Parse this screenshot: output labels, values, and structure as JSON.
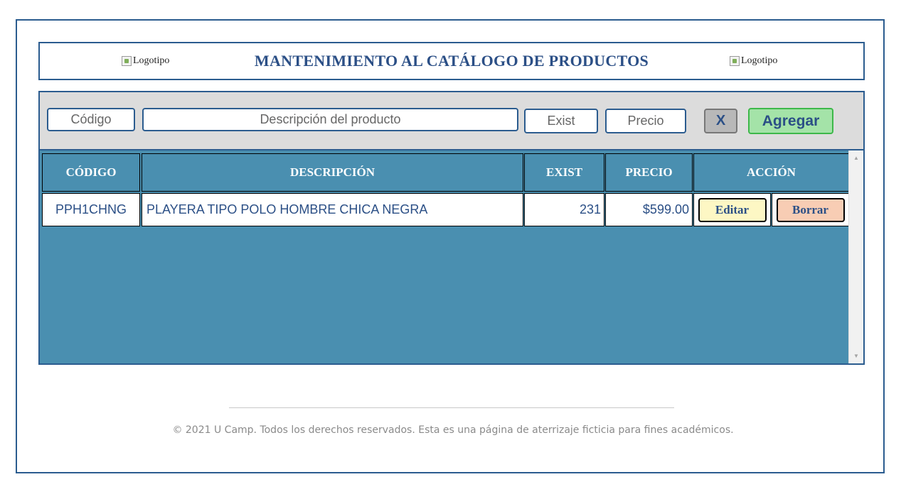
{
  "header": {
    "logo_left_alt": "Logotipo",
    "title": "MANTENIMIENTO AL CATÁLOGO DE PRODUCTOS",
    "logo_right_alt": "Logotipo"
  },
  "form": {
    "code_placeholder": "Código",
    "description_placeholder": "Descripción del producto",
    "exist_placeholder": "Exist",
    "price_placeholder": "Precio",
    "clear_label": "X",
    "add_label": "Agregar"
  },
  "table": {
    "columns": [
      "CÓDIGO",
      "DESCRIPCIÓN",
      "EXIST",
      "PRECIO",
      "ACCIÓN"
    ],
    "rows": [
      {
        "code": "PPH1CHNG",
        "description": "PLAYERA TIPO POLO HOMBRE CHICA NEGRA",
        "exist": "231",
        "price": "$599.00",
        "edit_label": "Editar",
        "delete_label": "Borrar"
      }
    ]
  },
  "footer": {
    "text": "© 2021 U Camp. Todos los derechos reservados. Esta es una página de aterrizaje ficticia para fines académicos."
  },
  "colors": {
    "primary": "#2b5c8f",
    "table_bg": "#4a8fb0",
    "form_bg": "#dcdcdc",
    "add_button": "#a4e3a8",
    "edit_button": "#fdf7c4",
    "delete_button": "#f8cdb4"
  }
}
